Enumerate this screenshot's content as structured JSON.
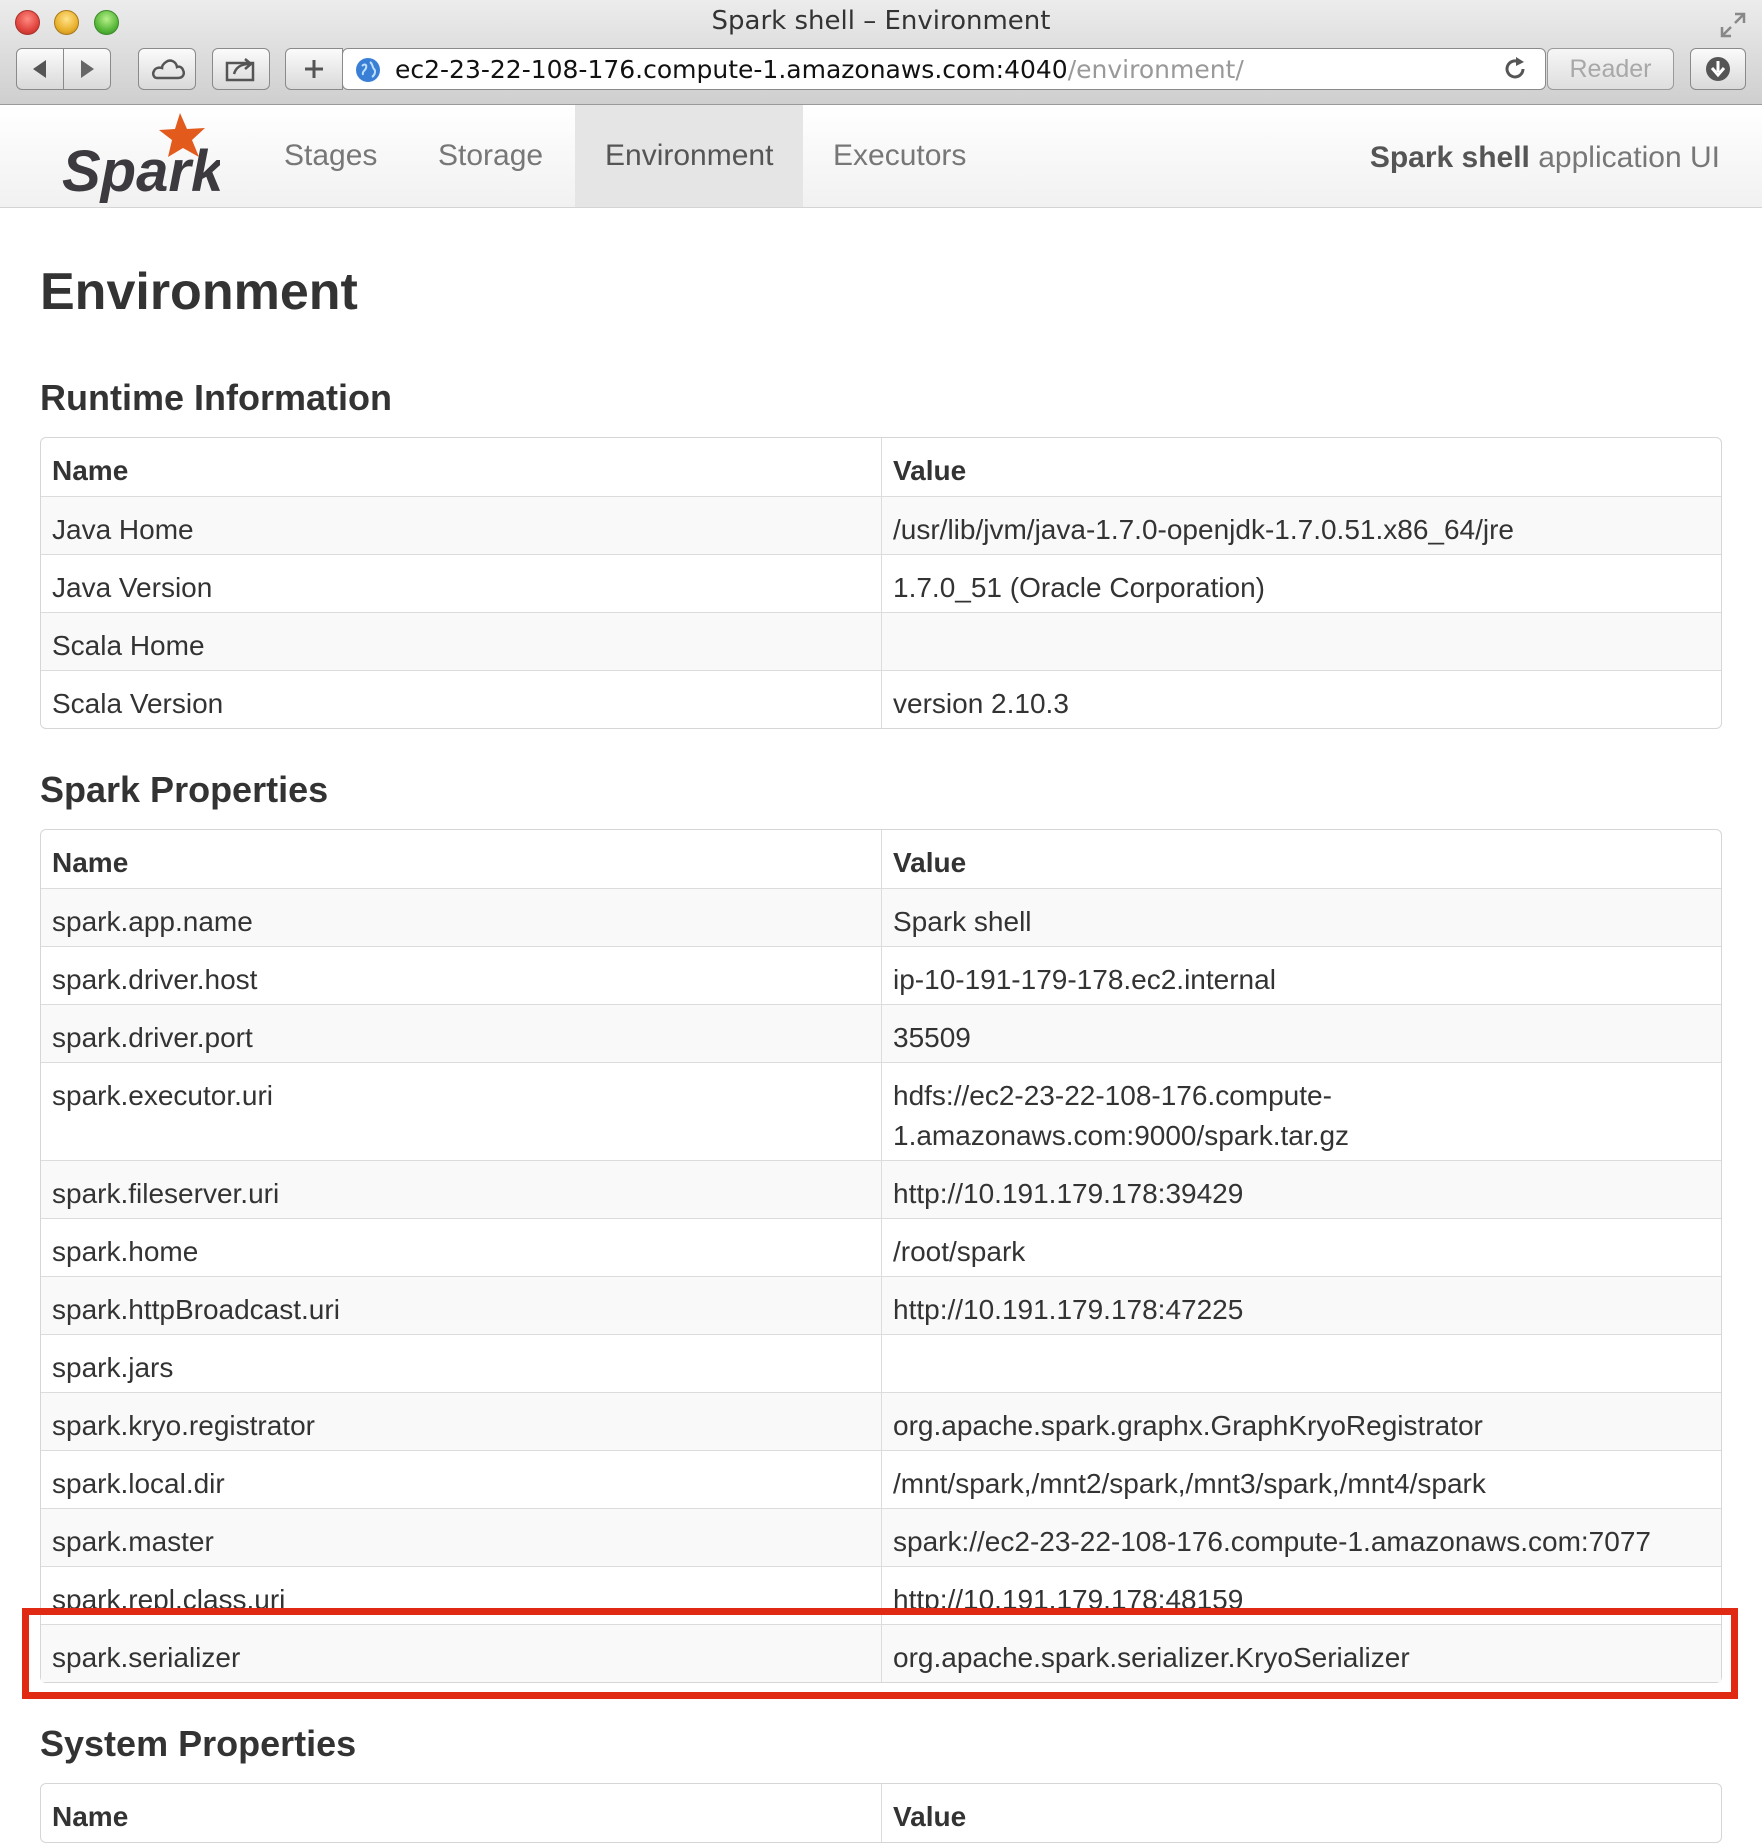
{
  "browser": {
    "window_title": "Spark shell – Environment",
    "url_host": "ec2-23-22-108-176.compute-1.amazonaws.com:4040",
    "url_path": "/environment/",
    "reader_label": "Reader"
  },
  "nav": {
    "logo_text": "Spark",
    "tabs": [
      {
        "label": "Stages"
      },
      {
        "label": "Storage"
      },
      {
        "label": "Environment"
      },
      {
        "label": "Executors"
      }
    ],
    "active_tab": "Environment",
    "app_name": "Spark shell",
    "app_suffix": " application UI"
  },
  "page": {
    "title": "Environment"
  },
  "columns": {
    "name": "Name",
    "value": "Value"
  },
  "sections": {
    "runtime": {
      "title": "Runtime Information",
      "rows": [
        {
          "name": "Java Home",
          "value": "/usr/lib/jvm/java-1.7.0-openjdk-1.7.0.51.x86_64/jre"
        },
        {
          "name": "Java Version",
          "value": "1.7.0_51 (Oracle Corporation)"
        },
        {
          "name": "Scala Home",
          "value": ""
        },
        {
          "name": "Scala Version",
          "value": "version 2.10.3"
        }
      ]
    },
    "spark": {
      "title": "Spark Properties",
      "rows": [
        {
          "name": "spark.app.name",
          "value": "Spark shell"
        },
        {
          "name": "spark.driver.host",
          "value": "ip-10-191-179-178.ec2.internal"
        },
        {
          "name": "spark.driver.port",
          "value": "35509"
        },
        {
          "name": "spark.executor.uri",
          "value_line1": "hdfs://ec2-23-22-108-176.compute-",
          "value_line2": "1.amazonaws.com:9000/spark.tar.gz"
        },
        {
          "name": "spark.fileserver.uri",
          "value": "http://10.191.179.178:39429"
        },
        {
          "name": "spark.home",
          "value": "/root/spark"
        },
        {
          "name": "spark.httpBroadcast.uri",
          "value": "http://10.191.179.178:47225"
        },
        {
          "name": "spark.jars",
          "value": ""
        },
        {
          "name": "spark.kryo.registrator",
          "value": "org.apache.spark.graphx.GraphKryoRegistrator"
        },
        {
          "name": "spark.local.dir",
          "value": "/mnt/spark,/mnt2/spark,/mnt3/spark,/mnt4/spark"
        },
        {
          "name": "spark.master",
          "value": "spark://ec2-23-22-108-176.compute-1.amazonaws.com:7077"
        },
        {
          "name": "spark.repl.class.uri",
          "value": "http://10.191.179.178:48159"
        },
        {
          "name": "spark.serializer",
          "value": "org.apache.spark.serializer.KryoSerializer"
        }
      ]
    },
    "system": {
      "title": "System Properties"
    }
  },
  "colors": {
    "highlight": "#e02a14",
    "spark_orange": "#e25a1c",
    "spark_text": "#3c3a3e"
  },
  "icons": [
    "close-window-icon",
    "minimize-window-icon",
    "zoom-window-icon",
    "back-arrow-icon",
    "forward-arrow-icon",
    "icloud-icon",
    "share-icon",
    "add-tab-icon",
    "globe-icon",
    "reload-icon",
    "download-icon",
    "fullscreen-icon",
    "spark-star-icon"
  ]
}
